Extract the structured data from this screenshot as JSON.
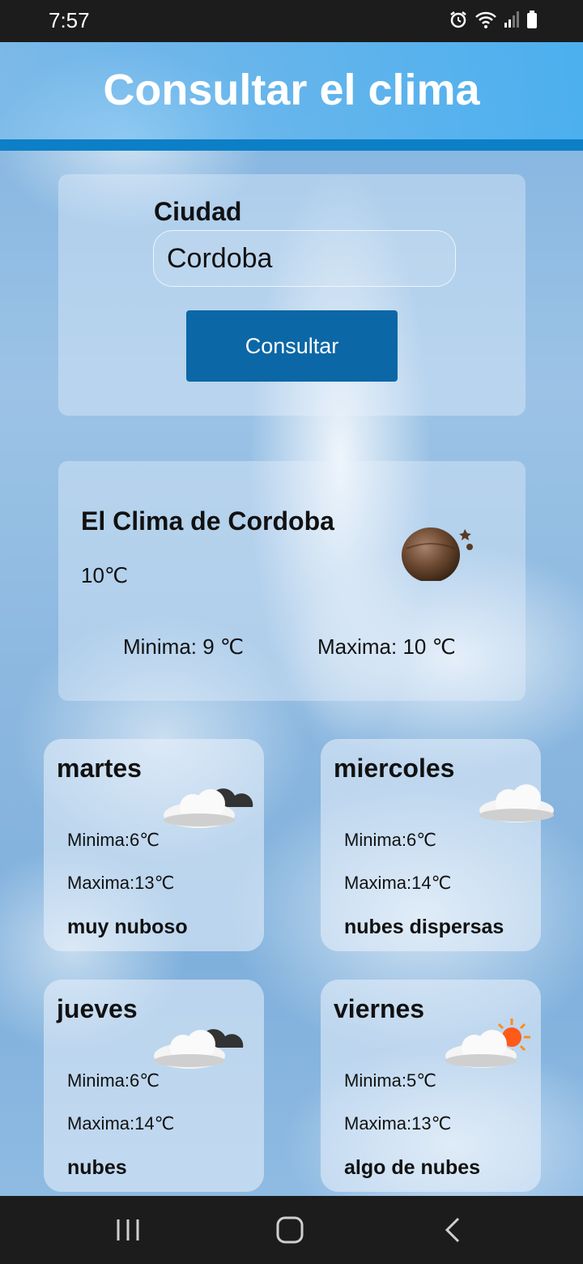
{
  "status_bar": {
    "time": "7:57",
    "icons": [
      "alarm-icon",
      "wifi-icon",
      "signal-icon",
      "battery-icon"
    ]
  },
  "header": {
    "title": "Consultar el clima"
  },
  "search": {
    "city_label": "Ciudad",
    "city_value": "Cordoba",
    "button_label": "Consultar"
  },
  "current": {
    "title": "El Clima de Cordoba",
    "temp": "10℃",
    "min": "Minima: 9 ℃",
    "max": "Maxima: 10 ℃",
    "icon": "night-moon-icon"
  },
  "forecast": [
    {
      "day": "martes",
      "min": "Minima:6℃",
      "max": "Maxima:13℃",
      "desc": "muy nuboso",
      "icon": "broken-clouds-icon"
    },
    {
      "day": "miercoles",
      "min": "Minima:6℃",
      "max": "Maxima:14℃",
      "desc": "nubes dispersas",
      "icon": "cloud-icon"
    },
    {
      "day": "jueves",
      "min": "Minima:6℃",
      "max": "Maxima:14℃",
      "desc": "nubes",
      "icon": "broken-clouds-icon"
    },
    {
      "day": "viernes",
      "min": "Minima:5℃",
      "max": "Maxima:13℃",
      "desc": "algo de nubes",
      "icon": "sun-cloud-icon"
    }
  ],
  "nav_bar": {
    "buttons": [
      "recent-apps-icon",
      "home-icon",
      "back-icon"
    ]
  },
  "colors": {
    "header_line": "#0d7fc6",
    "button": "#0b67a6"
  }
}
